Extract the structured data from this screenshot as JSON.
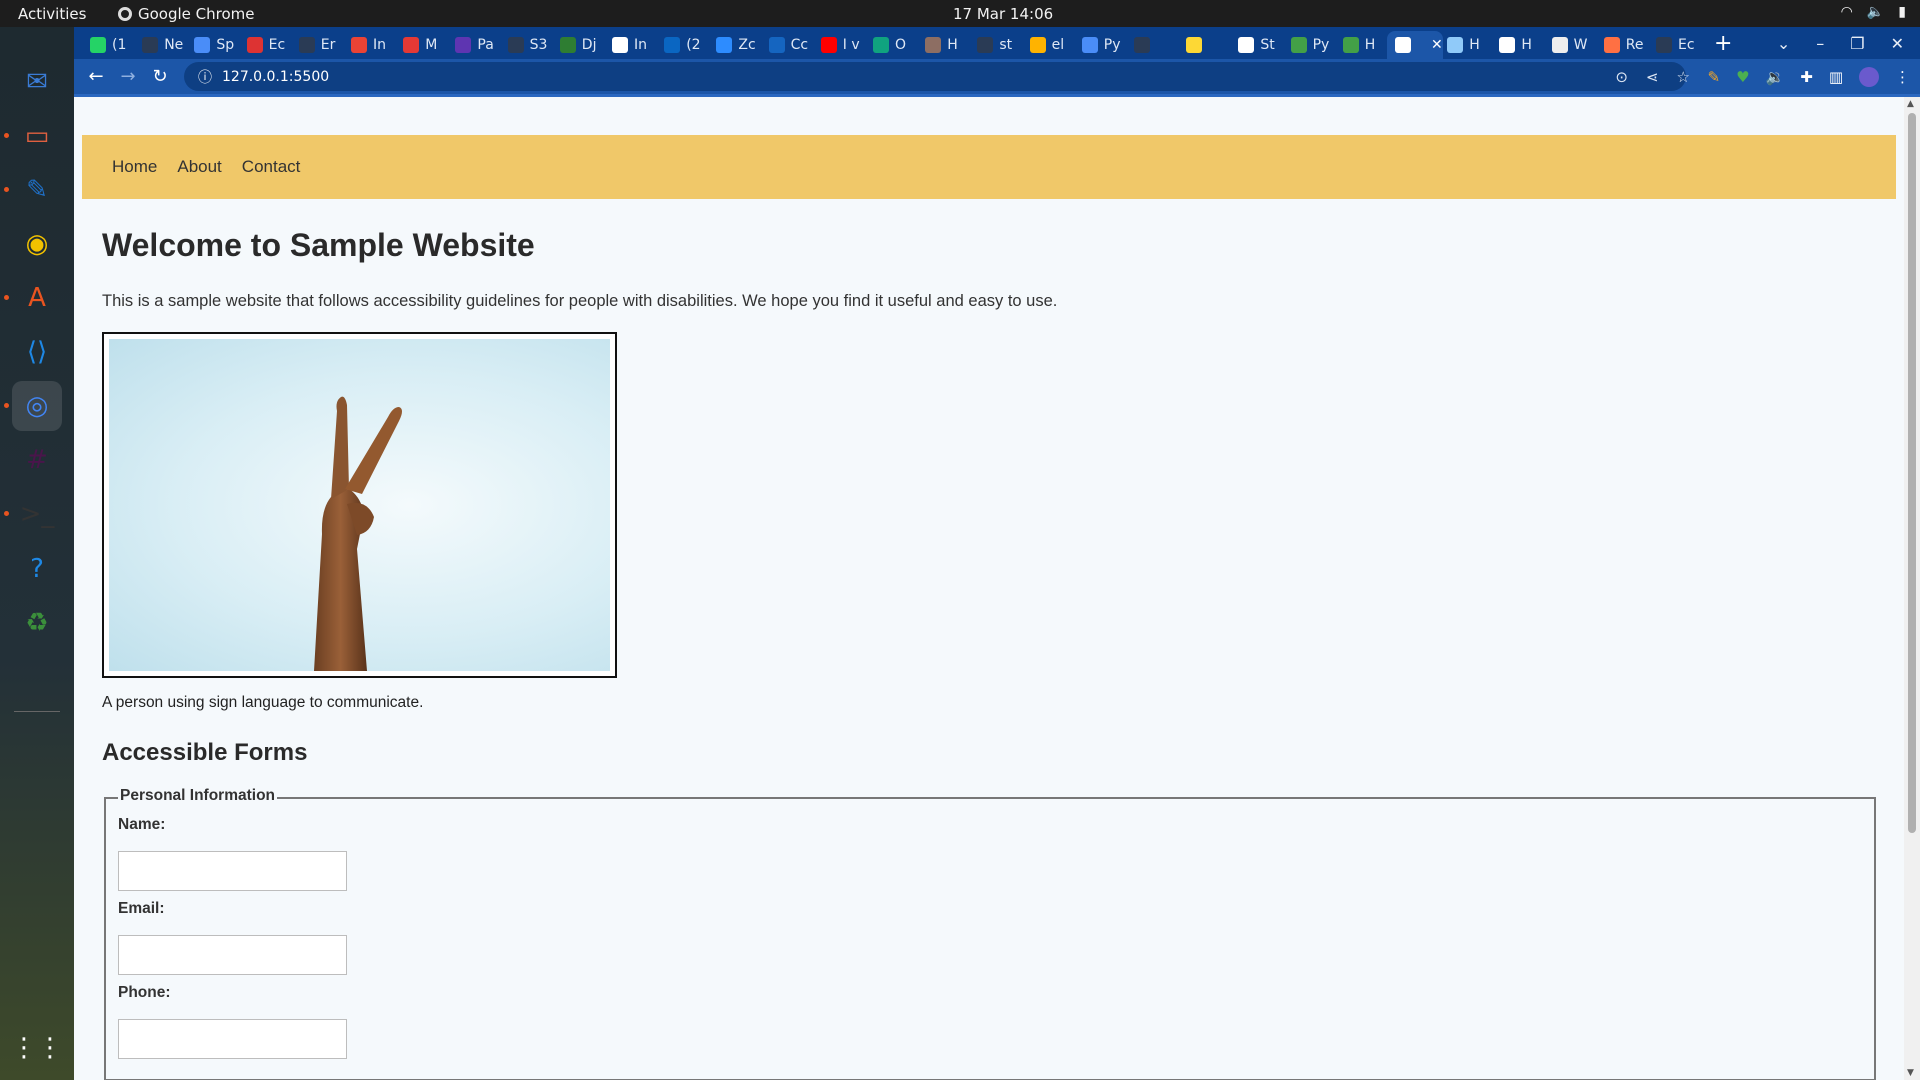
{
  "topbar": {
    "activities": "Activities",
    "app_name": "Google Chrome",
    "clock": "17 Mar  14:06"
  },
  "dock": {
    "items": [
      {
        "name": "thunderbird-icon",
        "color": "#3a7bd5"
      },
      {
        "name": "files-icon",
        "color": "#e06040"
      },
      {
        "name": "writer-icon",
        "color": "#1f6fc5"
      },
      {
        "name": "rhythmbox-icon",
        "color": "#f2c200"
      },
      {
        "name": "app-center-icon",
        "color": "#e95420"
      },
      {
        "name": "vscode-icon",
        "color": "#1e88e5"
      },
      {
        "name": "chrome-icon",
        "color": "#4285f4"
      },
      {
        "name": "slack-icon",
        "color": "#4a154b"
      },
      {
        "name": "terminal-icon",
        "color": "#333333"
      },
      {
        "name": "help-icon",
        "color": "#1e88e5"
      },
      {
        "name": "trash-icon",
        "color": "#3b8f3b"
      },
      {
        "name": "apps-grid-icon",
        "color": "#ffffff"
      }
    ]
  },
  "tabs": [
    {
      "label": "(1",
      "fav": "#25d366"
    },
    {
      "label": "Ne",
      "fav": "#2a3b55"
    },
    {
      "label": "Sp",
      "fav": "#4a8df8"
    },
    {
      "label": "Ec",
      "fav": "#d33"
    },
    {
      "label": "Er",
      "fav": "#2a3b55"
    },
    {
      "label": "In",
      "fav": "#ea4335"
    },
    {
      "label": "M",
      "fav": "#e53935"
    },
    {
      "label": "Pa",
      "fav": "#5e35b1"
    },
    {
      "label": "S3",
      "fav": "#2a3b55"
    },
    {
      "label": "Dj",
      "fav": "#2e7d32"
    },
    {
      "label": "In",
      "fav": "#ffffff"
    },
    {
      "label": "(2",
      "fav": "#0a66c2"
    },
    {
      "label": "Zc",
      "fav": "#2d8cff"
    },
    {
      "label": "Cc",
      "fav": "#1565c0"
    },
    {
      "label": "I v",
      "fav": "#ff0000"
    },
    {
      "label": "O",
      "fav": "#10a37f"
    },
    {
      "label": "H",
      "fav": "#8d6e63"
    },
    {
      "label": "st",
      "fav": "#2a3b55"
    },
    {
      "label": "el",
      "fav": "#ffb300"
    },
    {
      "label": "Py",
      "fav": "#4a8df8"
    },
    {
      "label": "",
      "fav": "#2a3b55"
    },
    {
      "label": "",
      "fav": "#fdd835"
    },
    {
      "label": "St",
      "fav": "#ffffff"
    },
    {
      "label": "Py",
      "fav": "#43a047"
    },
    {
      "label": "H",
      "fav": "#43a047"
    },
    {
      "label": "",
      "fav": "#ffffff",
      "active": true
    },
    {
      "label": "H",
      "fav": "#90caf9"
    },
    {
      "label": "H",
      "fav": "#ffffff"
    },
    {
      "label": "W",
      "fav": "#eeeeee"
    },
    {
      "label": "Re",
      "fav": "#ff7043"
    },
    {
      "label": "Ec",
      "fav": "#2a3b55"
    }
  ],
  "toolbar": {
    "url": "127.0.0.1:5500"
  },
  "site": {
    "nav": [
      "Home",
      "About",
      "Contact"
    ],
    "title": "Welcome to Sample Website",
    "intro": "This is a sample website that follows accessibility guidelines for people with disabilities. We hope you find it useful and easy to use.",
    "caption": "A person using sign language to communicate.",
    "forms_heading": "Accessible Forms",
    "fieldset_legend": "Personal Information",
    "fields": [
      {
        "label": "Name:",
        "value": ""
      },
      {
        "label": "Email:",
        "value": ""
      },
      {
        "label": "Phone:",
        "value": ""
      }
    ]
  },
  "colors": {
    "nav_bg": "#f0c869",
    "tabstrip_bg": "#0b3f8a",
    "toolbar_bg": "#1c56a8",
    "page_bg": "#f5f9fc"
  }
}
